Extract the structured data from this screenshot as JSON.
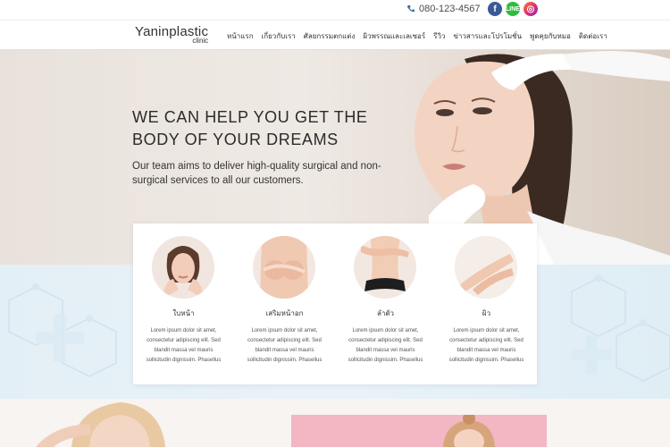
{
  "topbar": {
    "phone": "080-123-4567",
    "social": [
      {
        "name": "facebook",
        "glyph": "f"
      },
      {
        "name": "line",
        "glyph": "LINE"
      },
      {
        "name": "instagram",
        "glyph": "◎"
      }
    ]
  },
  "logo": {
    "brand": "Yaninplastic",
    "sub": "clinic"
  },
  "menu": [
    "หน้าแรก",
    "เกี่ยวกับเรา",
    "ศัลยกรรมตกแต่ง",
    "ผิวพรรณและเลเซอร์",
    "รีวิว",
    "ข่าวสารและโปรโมชั่น",
    "พูดคุยกับหมอ",
    "ติดต่อเรา"
  ],
  "hero": {
    "title_line1": "WE CAN HELP YOU GET THE",
    "title_line2": "BODY OF YOUR DREAMS",
    "subtitle": "Our team aims to deliver high-quality surgical and non-surgical services to all our customers."
  },
  "services": [
    {
      "title": "ใบหน้า",
      "desc": "Lorem ipsum dolor sit amet, consectetur adipiscing elit. Sed blandit massa vel mauris sollicitudin dignissim. Phasellus",
      "icon": "face-photo"
    },
    {
      "title": "เสริมหน้าอก",
      "desc": "Lorem ipsum dolor sit amet, consectetur adipiscing elit. Sed blandit massa vel mauris sollicitudin dignissim. Phasellus",
      "icon": "chest-photo"
    },
    {
      "title": "ลำตัว",
      "desc": "Lorem ipsum dolor sit amet, consectetur adipiscing elit. Sed blandit massa vel mauris sollicitudin dignissim. Phasellus",
      "icon": "body-photo"
    },
    {
      "title": "ผิว",
      "desc": "Lorem ipsum dolor sit amet, consectetur adipiscing elit. Sed blandit massa vel mauris sollicitudin dignissim. Phasellus",
      "icon": "skin-photo"
    }
  ],
  "colors": {
    "facebook": "#3b5998",
    "line": "#2bbf3b",
    "pink_block": "#f3b6c3",
    "band": "#e3eff6"
  }
}
